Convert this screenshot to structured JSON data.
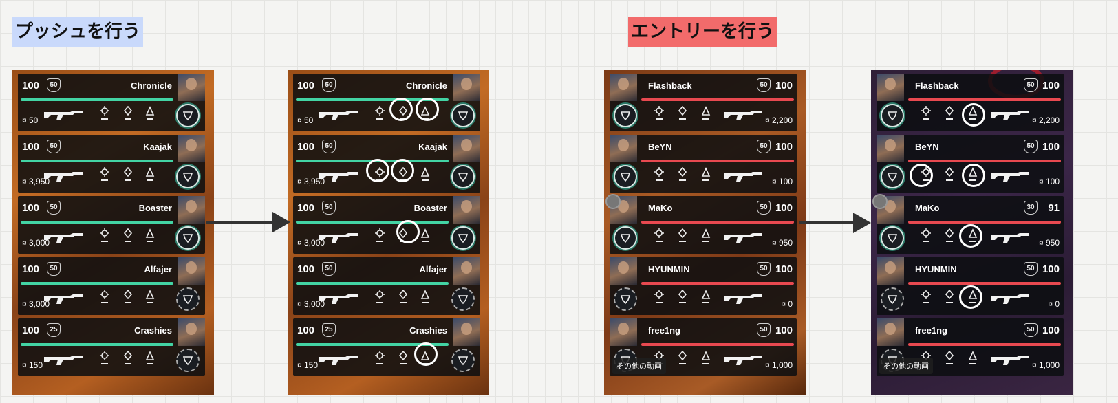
{
  "headings": {
    "push": "プッシュを行う",
    "entry": "エントリーを行う"
  },
  "push_players": [
    {
      "hp": "100",
      "shield": "50",
      "name": "Chronicle",
      "money": "¤ 50"
    },
    {
      "hp": "100",
      "shield": "50",
      "name": "Kaajak",
      "money": "¤ 3,950"
    },
    {
      "hp": "100",
      "shield": "50",
      "name": "Boaster",
      "money": "¤ 3,000"
    },
    {
      "hp": "100",
      "shield": "50",
      "name": "Alfajer",
      "money": "¤ 3,000"
    },
    {
      "hp": "100",
      "shield": "25",
      "name": "Crashies",
      "money": "¤ 150"
    }
  ],
  "entry_players_a": [
    {
      "hp": "100",
      "shield": "50",
      "name": "Flashback",
      "money": "¤ 2,200"
    },
    {
      "hp": "100",
      "shield": "50",
      "name": "BeYN",
      "money": "¤ 100"
    },
    {
      "hp": "100",
      "shield": "50",
      "name": "MaKo",
      "money": "¤ 950"
    },
    {
      "hp": "100",
      "shield": "50",
      "name": "HYUNMIN",
      "money": "¤ 0"
    },
    {
      "hp": "100",
      "shield": "50",
      "name": "free1ng",
      "money": "¤ 1,000"
    }
  ],
  "entry_players_b": [
    {
      "hp": "100",
      "shield": "50",
      "name": "Flashback",
      "money": "¤ 2,200"
    },
    {
      "hp": "100",
      "shield": "50",
      "name": "BeYN",
      "money": "¤ 100"
    },
    {
      "hp": "91",
      "shield": "30",
      "name": "MaKo",
      "money": "¤ 950"
    },
    {
      "hp": "100",
      "shield": "50",
      "name": "HYUNMIN",
      "money": "¤ 0"
    },
    {
      "hp": "100",
      "shield": "50",
      "name": "free1ng",
      "money": "¤ 1,000"
    }
  ],
  "overlay": {
    "more_videos": "その他の動画"
  },
  "colors": {
    "team_bar_push": "#43d4a4",
    "team_bar_entry": "#e84950",
    "highlight": "#ffffff"
  },
  "icons": {
    "arrow": "right-arrow-icon",
    "weapon": "rifle-icon",
    "currency": "credits-icon"
  }
}
